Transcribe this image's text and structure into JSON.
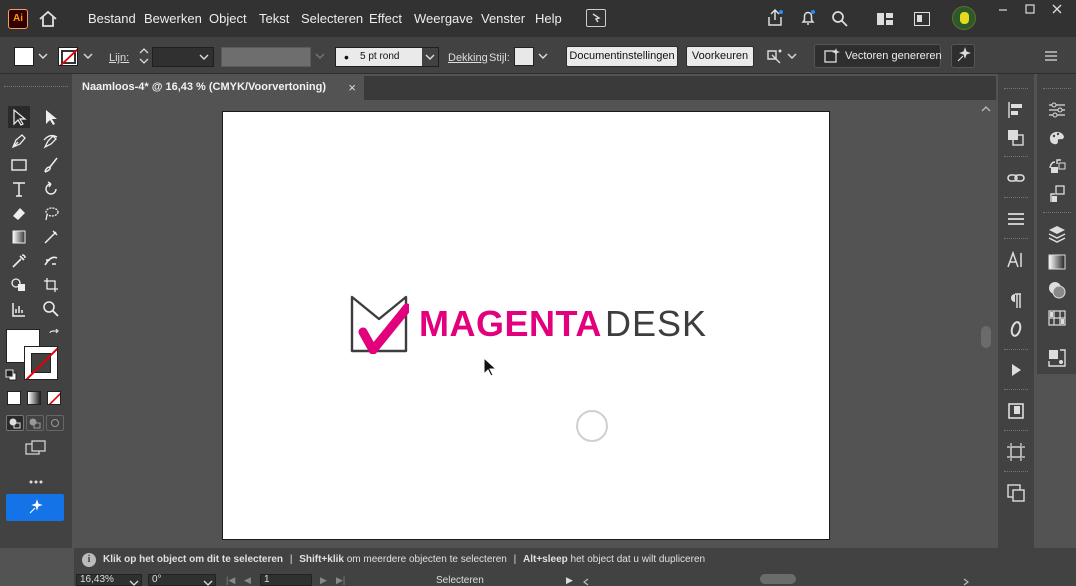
{
  "app": {
    "logo_text": "Ai"
  },
  "menu": [
    "Bestand",
    "Bewerken",
    "Object",
    "Tekst",
    "Selecteren",
    "Effect",
    "Weergave",
    "Venster",
    "Help"
  ],
  "control": {
    "stroke_label": "Lijn:",
    "brush_value": "5 pt rond",
    "opacity_label": "Dekking",
    "style_label": "Stijl:",
    "doc_settings": "Documentinstellingen",
    "preferences": "Voorkeuren",
    "generate_vectors": "Vectoren genereren"
  },
  "tab": {
    "title": "Naamloos-4* @ 16,43 % (CMYK/Voorvertoning)",
    "close": "×"
  },
  "logo": {
    "part1": "MAGENTA",
    "part2": "DESK"
  },
  "colors": {
    "magenta": "#e3007c",
    "dark_grey": "#3d3d3d"
  },
  "status": {
    "hint_bold1": "Klik op het object om dit te selecteren",
    "sep1": "|",
    "hint_bold2": "Shift+klik",
    "hint2": "om meerdere objecten te selecteren",
    "sep2": "|",
    "hint_bold3": "Alt+sleep",
    "hint3": "het object dat u wilt dupliceren"
  },
  "bottom": {
    "zoom": "16,43%",
    "rotate": "0°",
    "artboard": "1",
    "mode": "Selecteren"
  }
}
